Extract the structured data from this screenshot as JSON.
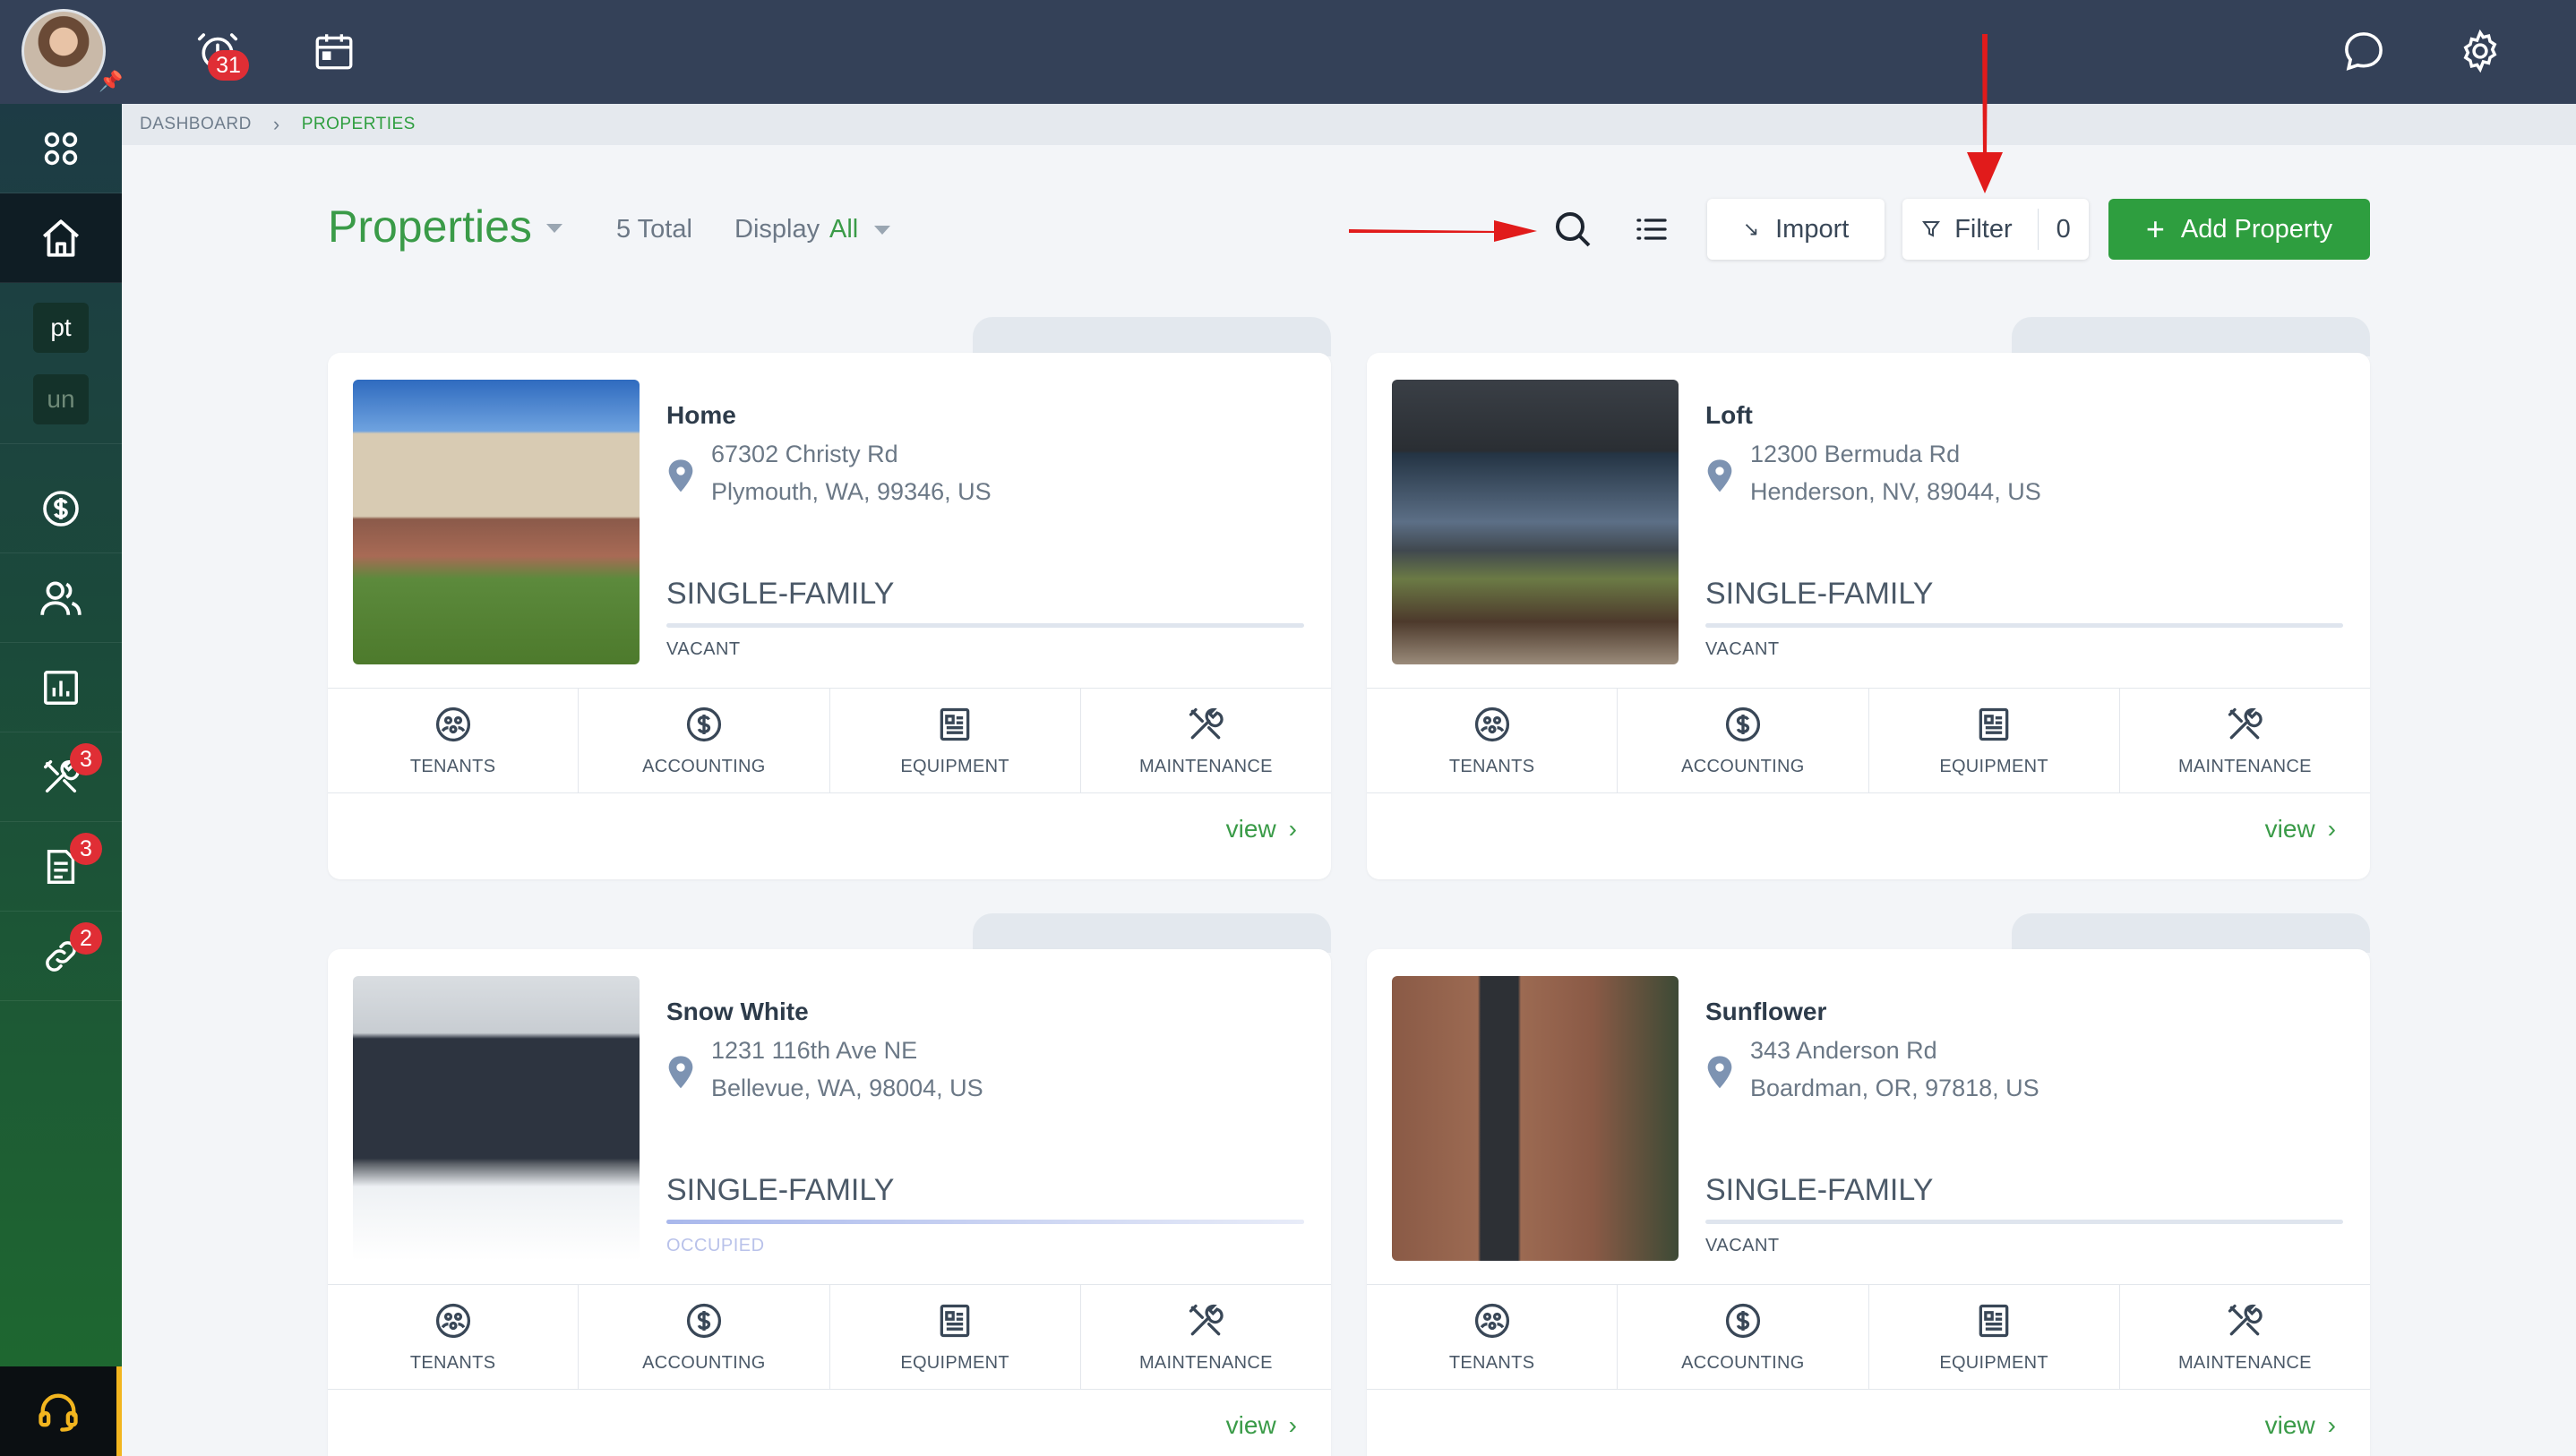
{
  "topbar": {
    "notification_count": "31",
    "icons": [
      "alarm-clock-icon",
      "calendar-icon",
      "chat-icon",
      "gear-icon"
    ]
  },
  "sidebar": {
    "items": [
      {
        "icon": "apps-grid-icon"
      },
      {
        "icon": "home-icon",
        "active": true
      },
      {
        "label": "pt"
      },
      {
        "label": "un"
      },
      {
        "icon": "dollar-icon"
      },
      {
        "icon": "users-icon"
      },
      {
        "icon": "chart-icon"
      },
      {
        "icon": "tools-icon",
        "badge": "3"
      },
      {
        "icon": "document-icon",
        "badge": "3"
      },
      {
        "icon": "link-icon",
        "badge": "2"
      }
    ],
    "support_icon": "headset-icon"
  },
  "breadcrumb": {
    "parent": "DASHBOARD",
    "current": "PROPERTIES"
  },
  "header": {
    "title": "Properties",
    "total": "5 Total",
    "display_label": "Display",
    "display_value": "All",
    "import_label": "Import",
    "filter_label": "Filter",
    "filter_count": "0",
    "add_label": "Add Property"
  },
  "actions": [
    "TENANTS",
    "ACCOUNTING",
    "EQUIPMENT",
    "MAINTENANCE"
  ],
  "view_label": "view",
  "properties": [
    {
      "name": "Home",
      "addr1": "67302 Christy Rd",
      "addr2": "Plymouth, WA, 99346, US",
      "type": "SINGLE-FAMILY",
      "status": "VACANT",
      "occupancy": 0
    },
    {
      "name": "Loft",
      "addr1": "12300 Bermuda Rd",
      "addr2": "Henderson, NV, 89044, US",
      "type": "SINGLE-FAMILY",
      "status": "VACANT",
      "occupancy": 0
    },
    {
      "name": "Snow White",
      "addr1": "1231 116th Ave NE",
      "addr2": "Bellevue, WA, 98004, US",
      "type": "SINGLE-FAMILY",
      "status": "OCCUPIED",
      "occupancy": 1
    },
    {
      "name": "Sunflower",
      "addr1": "343 Anderson Rd",
      "addr2": "Boardman, OR, 97818, US",
      "type": "SINGLE-FAMILY",
      "status": "VACANT",
      "occupancy": 0
    }
  ]
}
